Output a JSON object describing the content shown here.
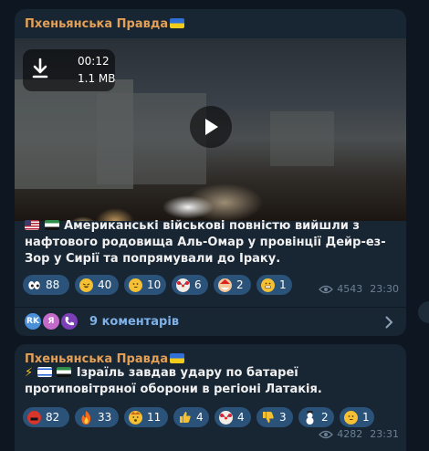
{
  "posts": [
    {
      "channel": "Пхеньянська Правда",
      "video": {
        "duration": "00:12",
        "size": "1.1 MB"
      },
      "text": "Американські військові повністю вийшли з нафтового родовища Аль-Омар у провінції Дейр-ез-Зор у Сирії та попрямували до Іраку.",
      "reactions": [
        {
          "icon": "eyes-emoji",
          "count": "88"
        },
        {
          "icon": "rofl-emoji",
          "count": "40"
        },
        {
          "icon": "thinking-emoji",
          "count": "10"
        },
        {
          "icon": "clown-emoji",
          "count": "6"
        },
        {
          "icon": "santa-emoji",
          "count": "2"
        },
        {
          "icon": "grin-emoji",
          "count": "1"
        }
      ],
      "views": "4543",
      "time": "23:30",
      "comments": {
        "avatars": [
          "RK",
          "Я",
          ""
        ],
        "label": "9 коментарів"
      }
    },
    {
      "channel": "Пхеньянська Правда",
      "text": "Ізраїль завдав удару по батареї протиповітряної оборони в регіоні Латакія.",
      "reactions": [
        {
          "icon": "swearing-emoji",
          "count": "82"
        },
        {
          "icon": "fire-emoji",
          "count": "33"
        },
        {
          "icon": "mind-blown-emoji",
          "count": "11"
        },
        {
          "icon": "thumbs-up-emoji",
          "count": "4"
        },
        {
          "icon": "clown-emoji",
          "count": "4"
        },
        {
          "icon": "thumbs-down-emoji",
          "count": "3"
        },
        {
          "icon": "snowman-emoji",
          "count": "2"
        },
        {
          "icon": "thinking-emoji",
          "count": "1"
        }
      ],
      "views": "4282",
      "time": "23:31"
    }
  ],
  "colors": {
    "background": "#0e1621",
    "bubble": "#182533",
    "channel": "#e3a056",
    "reaction_bg": "#2b5278",
    "link": "#7fb2e8",
    "meta": "#6d8094"
  }
}
